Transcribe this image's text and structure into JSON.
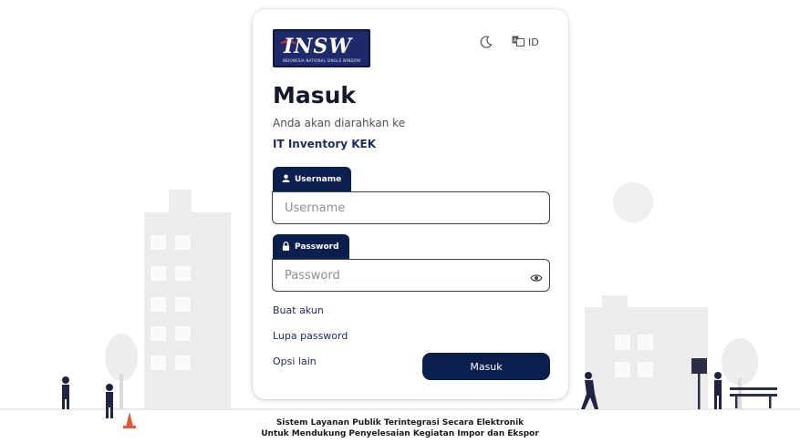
{
  "header": {
    "logo_text": "INSW",
    "logo_tagline": "INDONESIA NATIONAL SINGLE WINDOW",
    "theme_icon": "moon-icon",
    "language_icon": "translate-icon",
    "language_label": "ID"
  },
  "login": {
    "title": "Masuk",
    "redirect_text": "Anda akan diarahkan ke",
    "app_name": "IT Inventory KEK",
    "username_label": "Username",
    "username_placeholder": "Username",
    "username_icon": "user-icon",
    "password_label": "Password",
    "password_placeholder": "Password",
    "password_icon": "lock-icon",
    "eye_icon": "eye-icon",
    "submit_label": "Masuk"
  },
  "links": {
    "create_account": "Buat akun",
    "forgot_password": "Lupa password",
    "other_options": "Opsi lain"
  },
  "footer": {
    "line1": "Sistem Layanan Publik Terintegrasi Secara Elektronik",
    "line2": "Untuk Mendukung Penyelesaian Kegiatan Impor dan Ekspor"
  },
  "colors": {
    "primary": "#0b1f4f",
    "accent_link": "#1c2e63",
    "background_illustration": "#e9e9e9"
  }
}
